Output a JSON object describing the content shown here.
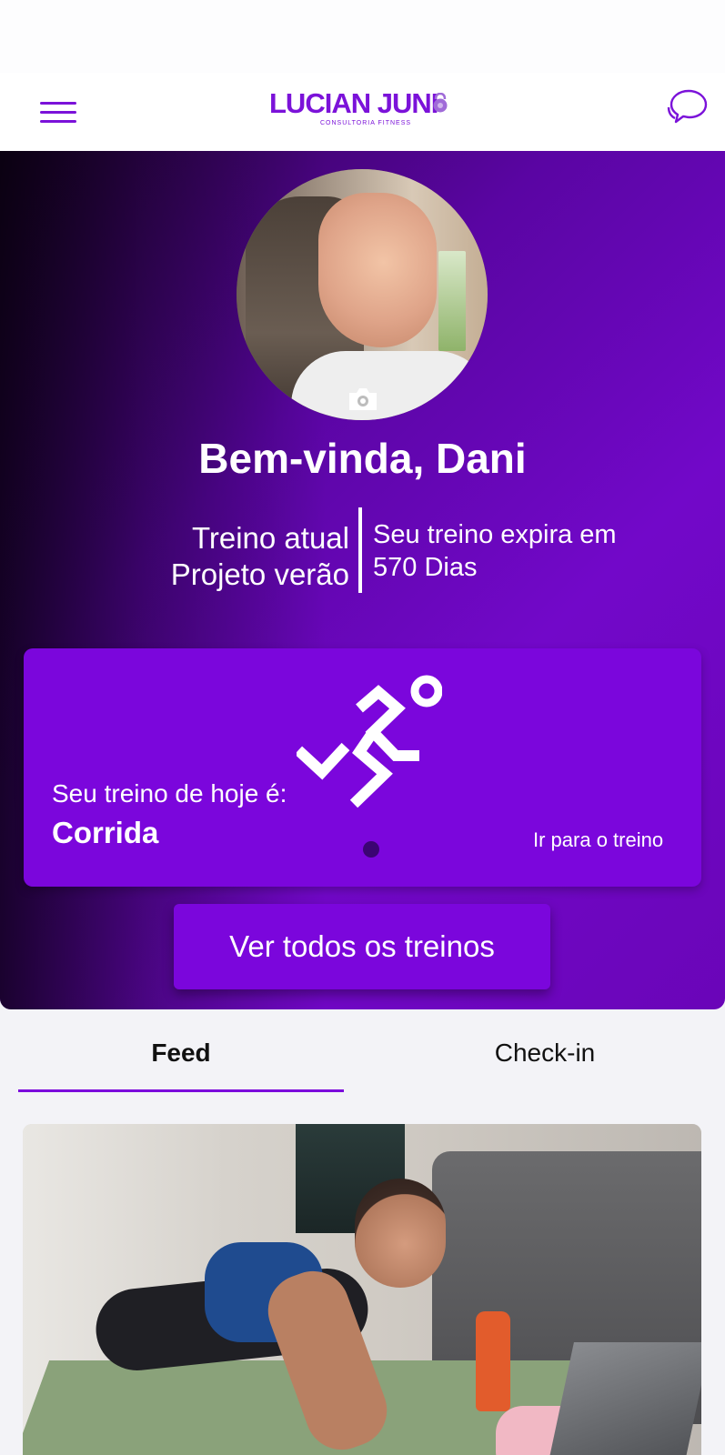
{
  "header": {
    "logo_text": "LUCIAN JUNI",
    "logo_subtitle": "CONSULTORIA FITNESS"
  },
  "hero": {
    "welcome": "Bem-vinda, Dani",
    "plan_label": "Treino atual",
    "plan_name": "Projeto verão",
    "expiry_label": "Seu treino expira em",
    "expiry_value": "570 Dias"
  },
  "today": {
    "label": "Seu treino de hoje é:",
    "workout": "Corrida",
    "link": "Ir para o treino",
    "icon": "runner-icon"
  },
  "buttons": {
    "all_workouts": "Ver todos os treinos"
  },
  "tabs": [
    {
      "label": "Feed",
      "active": true
    },
    {
      "label": "Check-in",
      "active": false
    }
  ],
  "colors": {
    "accent": "#7b06dc",
    "hero_dark": "#2a0344",
    "background": "#f3f3f7"
  }
}
